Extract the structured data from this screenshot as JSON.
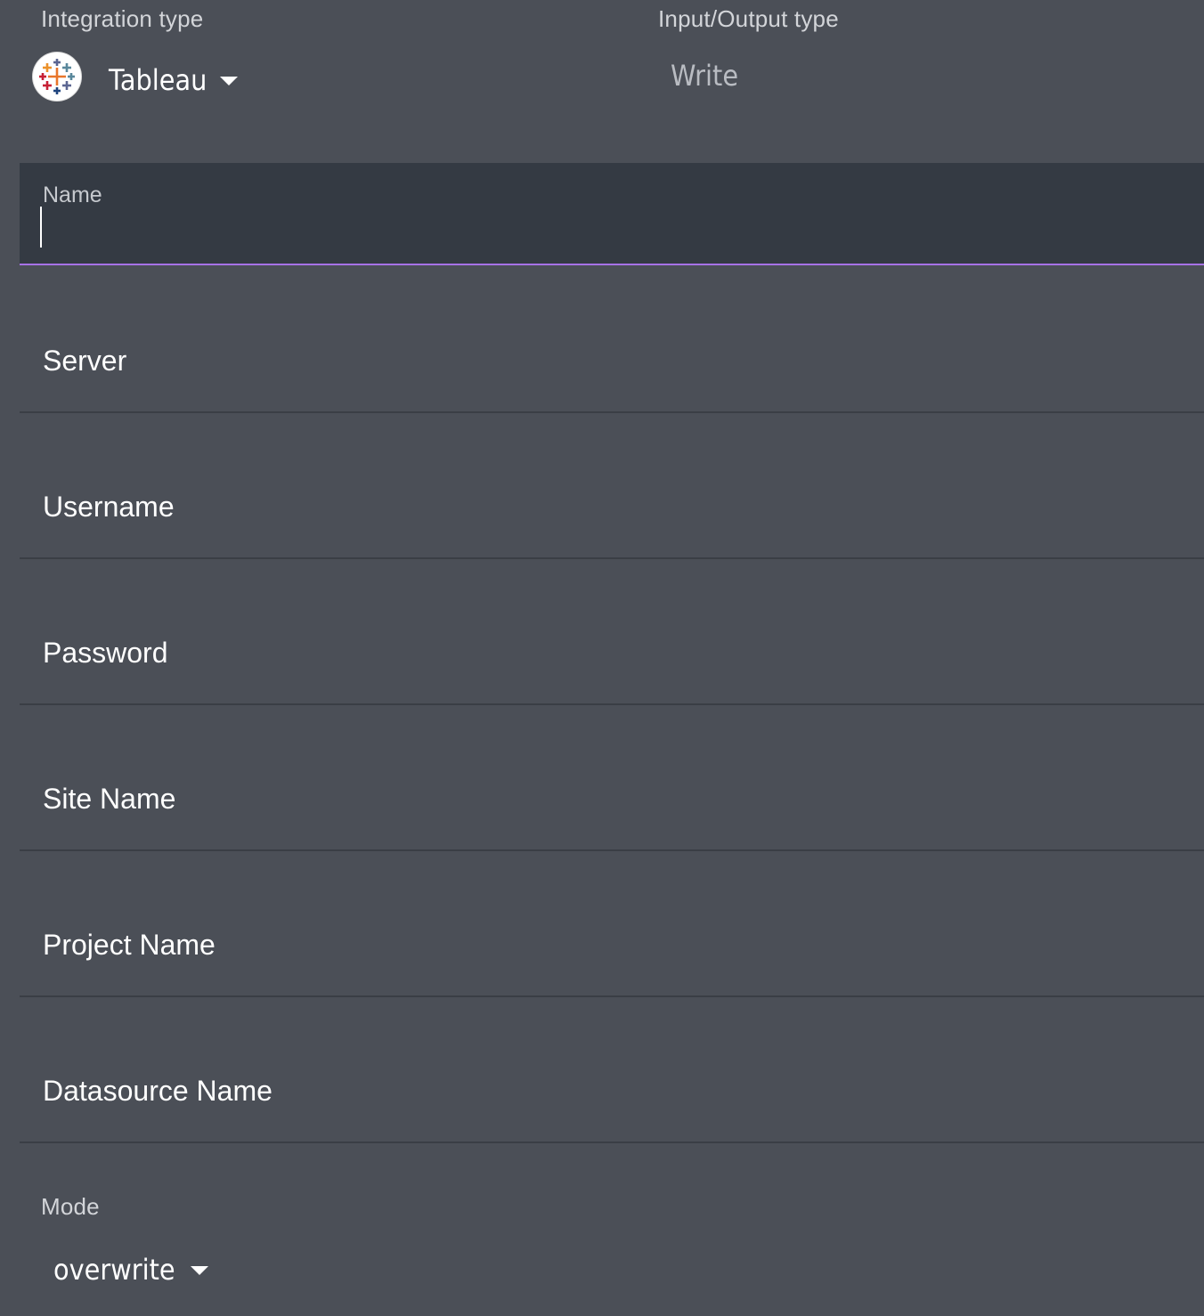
{
  "integration": {
    "label": "Integration type",
    "selected": "Tableau",
    "icon": "tableau-logo-icon"
  },
  "io": {
    "label": "Input/Output type",
    "value": "Write"
  },
  "form": {
    "name_label": "Name",
    "name_value": "",
    "server_label": "Server",
    "username_label": "Username",
    "password_label": "Password",
    "site_label": "Site Name",
    "project_label": "Project Name",
    "datasource_label": "Datasource Name"
  },
  "mode": {
    "label": "Mode",
    "selected": "overwrite"
  },
  "colors": {
    "background": "#4b4f57",
    "focused_field": "#343a43",
    "focus_accent": "#a772e6",
    "divider": "#3a3e45"
  }
}
